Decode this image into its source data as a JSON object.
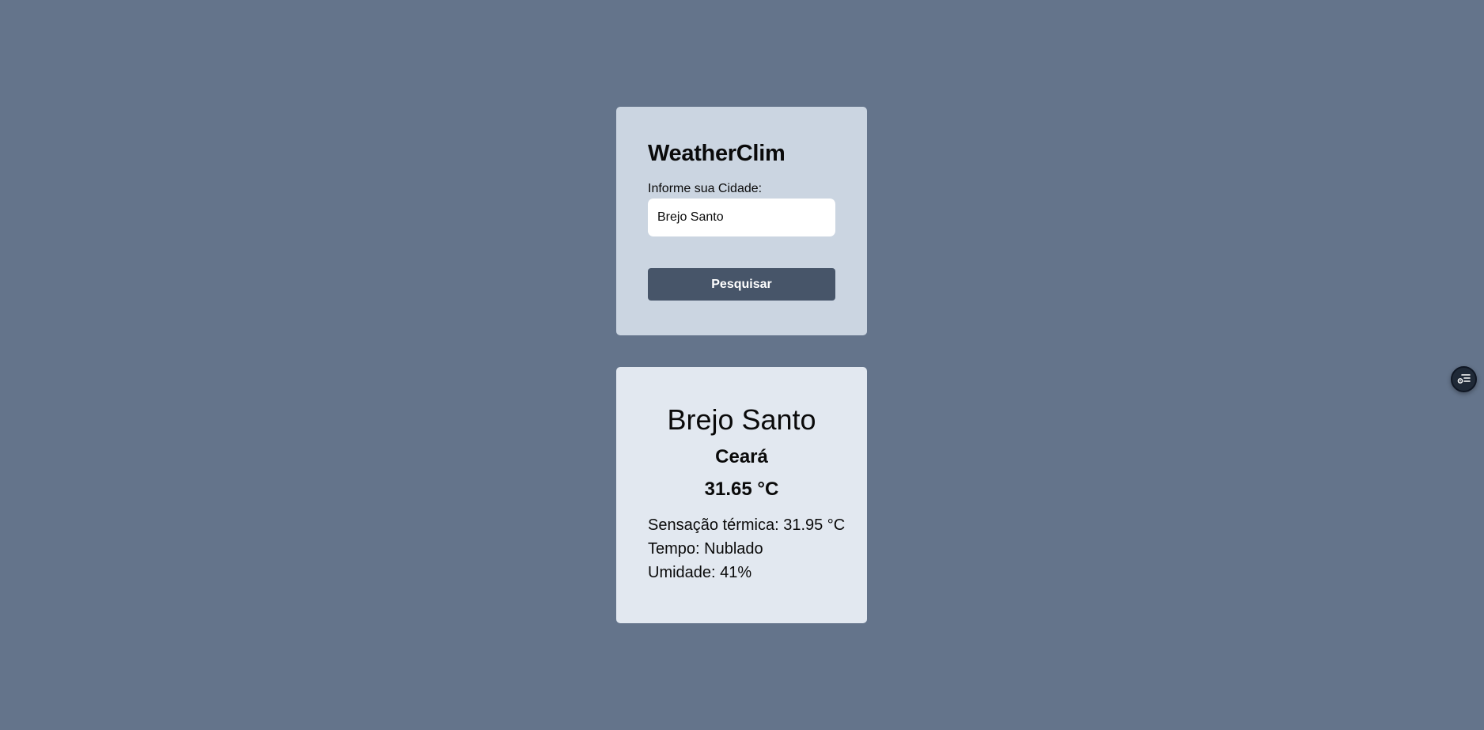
{
  "app": {
    "title": "WeatherClim"
  },
  "search": {
    "label": "Informe sua Cidade:",
    "value": "Brejo Santo",
    "button_label": "Pesquisar"
  },
  "result": {
    "city": "Brejo Santo",
    "state": "Ceará",
    "temperature": "31.65 °C",
    "feels_like": "Sensação térmica: 31.95 °C",
    "weather": "Tempo: Nublado",
    "humidity": "Umidade: 41%"
  },
  "floating_button": {
    "icon": "list-settings-icon"
  },
  "colors": {
    "background": "#64748b",
    "search_card": "#cbd5e1",
    "result_card": "#e2e8f0",
    "button": "#475569"
  }
}
